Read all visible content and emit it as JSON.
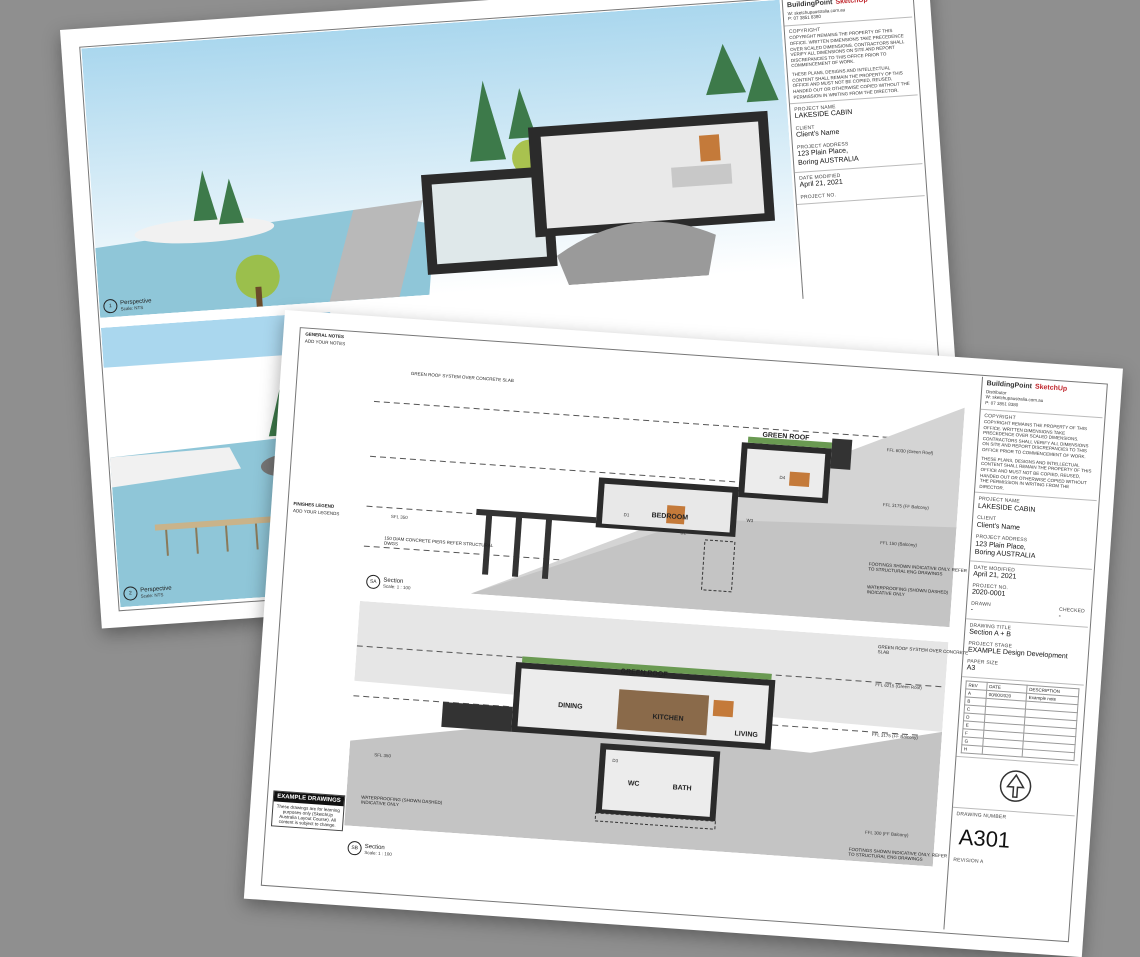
{
  "titleblock": {
    "brand_bp": "BuildingPoint",
    "brand_su": "SketchUp",
    "brand_sub": "Distributor",
    "web": "W: sketchupaustralia.com.au",
    "phone": "P: 07 3851 8380",
    "copyright_heading": "COPYRIGHT",
    "copyright_text": "COPYRIGHT REMAINS THE PROPERTY OF THIS OFFICE. WRITTEN DIMENSIONS TAKE PRECEDENCE OVER SCALED DIMENSIONS. CONTRACTORS SHALL VERIFY ALL DIMENSIONS ON SITE AND REPORT DISCREPANCIES TO THIS OFFICE PRIOR TO COMMENCEMENT OF WORK.",
    "ip_text": "THESE PLANS, DESIGNS AND INTELLECTUAL CONTENT SHALL REMAIN THE PROPERTY OF THIS OFFICE AND MUST NOT BE COPIED, REUSED, HANDED OUT OR OTHERWISE COPIED WITHOUT THE PERMISSION IN WRITING FROM THE DIRECTOR.",
    "project_name_label": "PROJECT NAME",
    "project_name": "LAKESIDE CABIN",
    "client_label": "CLIENT",
    "client": "Client's Name",
    "address_label": "PROJECT ADDRESS",
    "address_line1": "123 Plain Place,",
    "address_line2": "Boring AUSTRALIA",
    "date_label": "DATE MODIFIED",
    "date": "April 21, 2021",
    "project_no_label": "PROJECT NO.",
    "project_no": "2020-0001",
    "drawn_label": "DRAWN",
    "checked_label": "CHECKED",
    "drawn": "-",
    "checked": "-",
    "drawing_title_label": "DRAWING TITLE",
    "drawing_title": "Section A + B",
    "stage_label": "PROJECT STAGE",
    "stage": "EXAMPLE Design Development",
    "paper_label": "PAPER SIZE",
    "paper": "A3",
    "rev_headers": [
      "REV",
      "DATE",
      "DESCRIPTION"
    ],
    "rev_rows": [
      [
        "A",
        "00/00/2020",
        "Example note"
      ],
      [
        "B",
        "",
        ""
      ],
      [
        "C",
        "",
        ""
      ],
      [
        "D",
        "",
        ""
      ],
      [
        "E",
        "",
        ""
      ],
      [
        "F",
        "",
        ""
      ],
      [
        "G",
        "",
        ""
      ],
      [
        "H",
        "",
        ""
      ]
    ],
    "drawing_number_label": "DRAWING NUMBER",
    "drawing_number": "A301",
    "revision": "REVISION A"
  },
  "back_sheet": {
    "views": [
      {
        "number": "1",
        "sheet": "A301",
        "title": "Perspective",
        "scale": "Scale: NTS"
      },
      {
        "number": "2",
        "sheet": "A301",
        "title": "Perspective",
        "scale": "Scale: NTS"
      }
    ],
    "project_no_label": "PROJECT NO."
  },
  "front_sheet": {
    "general_notes": "GENERAL NOTES",
    "add_notes": "ADD YOUR NOTES",
    "finishes_legend": "FINISHES LEGEND",
    "add_legends": "ADD YOUR LEGENDS",
    "example_title": "EXAMPLE DRAWINGS",
    "example_text": "These drawings are for learning purposes only (SketchUp Australia Layout Course). All content is subject to change.",
    "section_a": {
      "number": "SA",
      "sheet": "A301",
      "title": "Section",
      "scale": "Scale: 1 : 100"
    },
    "section_b": {
      "number": "SB",
      "sheet": "A301",
      "title": "Section",
      "scale": "Scale: 1 : 100"
    },
    "notes_a": [
      "GREEN ROOF SYSTEM OVER CONCRETE SLAB",
      "150 diam CONCRETE PIERS REFER STRUCTURAL DWGS",
      "FOOTINGS SHOWN INDICATIVE ONLY. REFER TO STRUCTURAL ENG DRAWINGS",
      "WATERPROOFING (SHOWN DASHED) INDICATIVE ONLY"
    ],
    "notes_b": [
      "GREEN ROOF SYSTEM OVER CONCRETE SLAB",
      "WATERPROOFING (SHOWN DASHED) INDICATIVE ONLY",
      "FOOTINGS SHOWN INDICATIVE ONLY. REFER TO STRUCTURAL ENG DRAWINGS"
    ],
    "rooms_a": [
      "GREEN ROOF",
      "BEDROOM"
    ],
    "rooms_b": [
      "GREEN ROOF",
      "DINING",
      "KITCHEN",
      "LIVING",
      "WC",
      "BATH"
    ],
    "tags_a": [
      "D1",
      "D2",
      "D4",
      "W3"
    ],
    "tags_b": [
      "D3"
    ],
    "levels_a": [
      "FFL 6030 (Green Roof)",
      "FFL 3175 (FF Balcony)",
      "SFL 350",
      "FFL 150 (Balcony)"
    ],
    "levels_b": [
      "FFL 6215 (Green Roof)",
      "FFL 3175 (FF Balcony)",
      "SFL 350",
      "FFL 300 (FF Balcony)"
    ]
  }
}
